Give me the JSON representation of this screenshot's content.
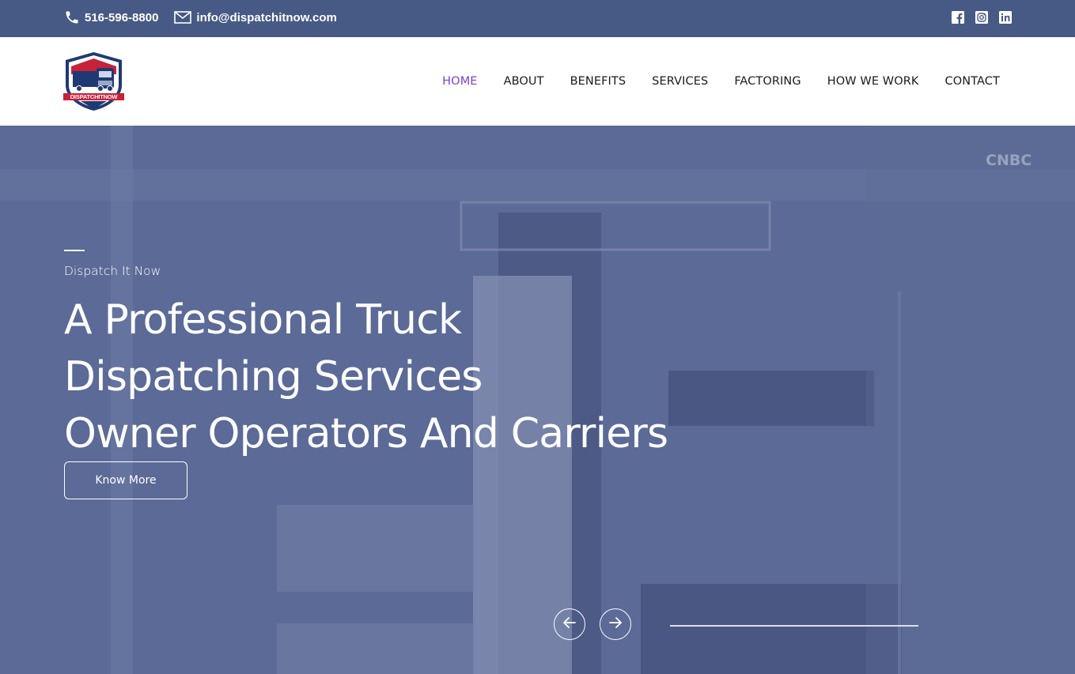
{
  "topbar": {
    "phone": "516-596-8800",
    "email": "info@dispatchitnow.com",
    "social": [
      {
        "icon": "facebook-icon"
      },
      {
        "icon": "instagram-icon"
      },
      {
        "icon": "linkedin-icon"
      }
    ]
  },
  "header": {
    "logo_text": "DISPATCHITNOW",
    "nav": [
      {
        "label": "HOME",
        "active": true
      },
      {
        "label": "ABOUT"
      },
      {
        "label": "BENEFITS"
      },
      {
        "label": "SERVICES"
      },
      {
        "label": "FACTORING"
      },
      {
        "label": "HOW WE WORK"
      },
      {
        "label": "CONTACT"
      }
    ]
  },
  "hero": {
    "subtitle": "Dispatch It Now",
    "title_lines": [
      "A Professional Truck",
      "Dispatching Services",
      "Owner Operators And Carriers"
    ],
    "button_label": "Know More",
    "watermark": "CNBC"
  },
  "colors": {
    "topbar_bg": "#475a85",
    "nav_active": "#7b3fd1",
    "hero_overlay": "#5a6893"
  }
}
